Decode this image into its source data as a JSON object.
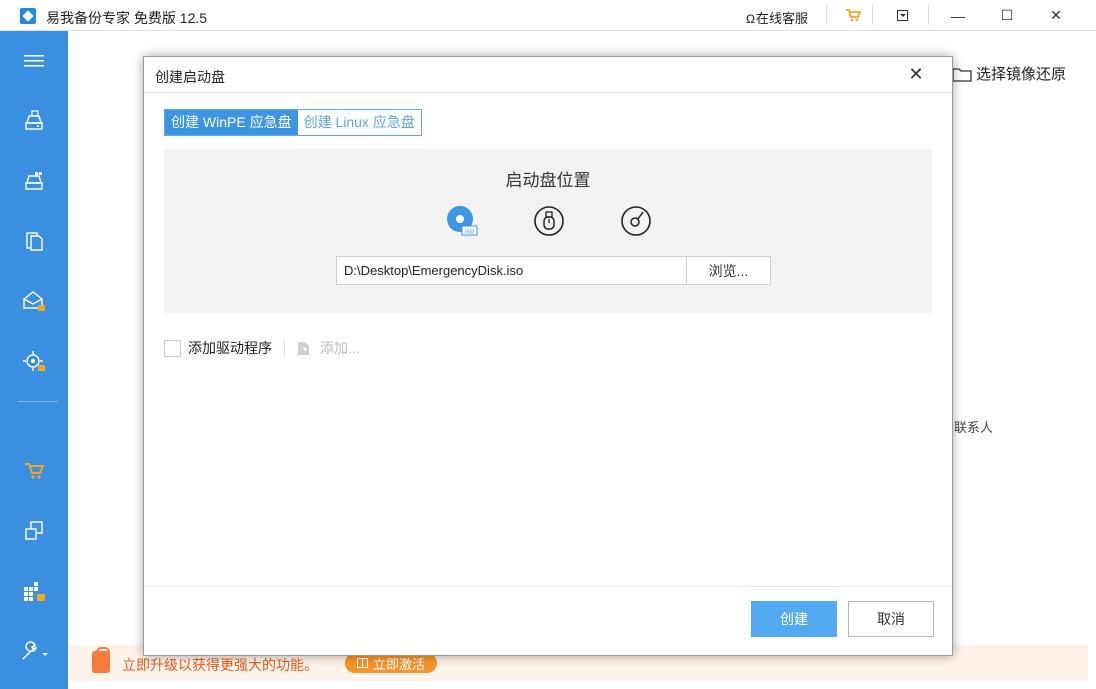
{
  "titlebar": {
    "app_title": "易我备份专家 免费版 12.5",
    "online_service": "在线客服",
    "minimize": "—",
    "maximize": "☐",
    "close": "✕"
  },
  "sidebar": {
    "items": [
      {
        "icon": "menu-icon"
      },
      {
        "icon": "disk-backup-icon"
      },
      {
        "icon": "system-backup-icon"
      },
      {
        "icon": "file-backup-icon"
      },
      {
        "icon": "mail-backup-locked-icon"
      },
      {
        "icon": "smart-backup-locked-icon"
      },
      {
        "icon": "cart-icon"
      },
      {
        "icon": "clone-icon"
      },
      {
        "icon": "tools-grid-locked-icon"
      },
      {
        "icon": "wrench-dropdown-icon"
      }
    ]
  },
  "background": {
    "restore_label": "选择镜像还原",
    "contact_text": "联系人"
  },
  "promo": {
    "text": "立即升级以获得更强大的功能。",
    "activate_label": "立即激活"
  },
  "dialog": {
    "title": "创建启动盘",
    "close": "✕",
    "tabs": [
      {
        "label": "创建 WinPE 应急盘",
        "active": true
      },
      {
        "label": "创建 Linux 应急盘",
        "active": false
      }
    ],
    "location_title": "启动盘位置",
    "location_options": [
      {
        "icon": "iso-disc-icon",
        "selected": true
      },
      {
        "icon": "usb-drive-icon",
        "selected": false
      },
      {
        "icon": "cd-dvd-icon",
        "selected": false
      }
    ],
    "path_value": "D:\\Desktop\\EmergencyDisk.iso",
    "browse_label": "浏览...",
    "add_driver_label": "添加驱动程序",
    "add_label": "添加...",
    "create_label": "创建",
    "cancel_label": "取消"
  },
  "colors": {
    "sidebar": "#3b8fe0",
    "accent": "#3d95e4",
    "primary_button": "#54aaf0",
    "promo_text": "#e85c1a",
    "promo_button": "#f7942a"
  }
}
